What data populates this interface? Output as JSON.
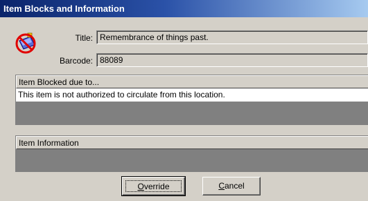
{
  "window": {
    "title": "Item Blocks and Information"
  },
  "icon": "blocked-item-icon",
  "fields": {
    "title_label": "Title:",
    "title_value": "Remembrance of things past.",
    "barcode_label": "Barcode:",
    "barcode_value": "88089"
  },
  "blocked": {
    "header": "Item Blocked due to...",
    "rows": [
      "This item is not authorized to circulate from this location."
    ]
  },
  "info": {
    "header": "Item Information",
    "rows": []
  },
  "buttons": {
    "override_mnemonic": "O",
    "override_rest": "verride",
    "cancel_mnemonic": "C",
    "cancel_rest": "ancel"
  }
}
